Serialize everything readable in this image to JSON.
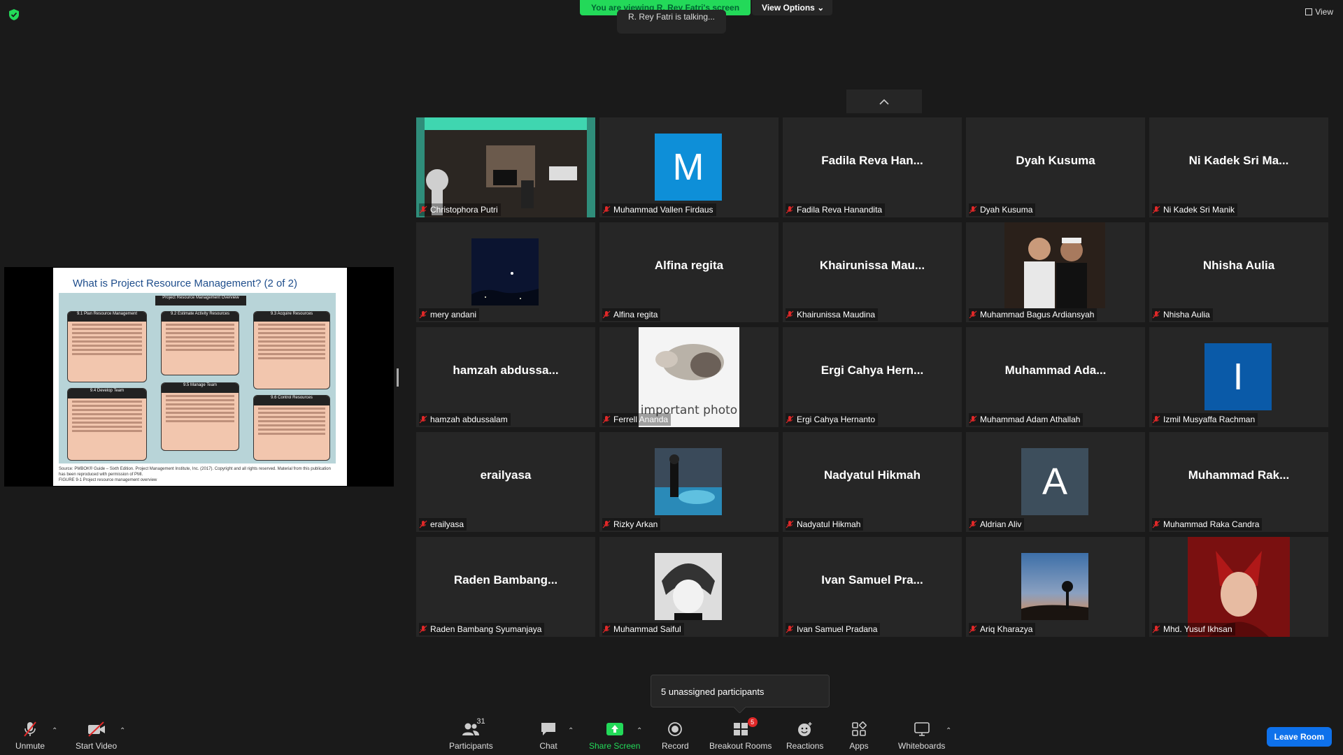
{
  "banner": {
    "viewing_text": "You are viewing R. Rey Fatri's screen",
    "view_options": "View Options",
    "talking": "R. Rey Fatri is talking..."
  },
  "view_label": "View",
  "slide": {
    "title": "What is Project Resource Management? (2 of 2)",
    "diagram_header": "Project Resource Management Overview",
    "boxes": [
      "9.1 Plan Resource Management",
      "9.2 Estimate Activity Resources",
      "9.3 Acquire Resources",
      "9.4 Develop Team",
      "9.5 Manage Team",
      "9.6 Control Resources"
    ],
    "source": "Source: PMBOK® Guide – Sixth Edition. Project Management Institute, Inc. (2017). Copyright and all rights reserved. Material from this publication has been reproduced with permission of PMI.",
    "figure": "FIGURE 9-1   Project resource management overview"
  },
  "participants": [
    {
      "display": "",
      "name": "Christophora Putri",
      "kind": "room-photo"
    },
    {
      "display": "M",
      "name": "Muhammad Vallen Firdaus",
      "kind": "letter",
      "color": "#0e8fd8"
    },
    {
      "display": "Fadila Reva Han...",
      "name": "Fadila Reva Hanandita",
      "kind": "text"
    },
    {
      "display": "Dyah Kusuma",
      "name": "Dyah Kusuma",
      "kind": "text"
    },
    {
      "display": "Ni Kadek Sri Ma...",
      "name": "Ni Kadek Sri Manik",
      "kind": "text"
    },
    {
      "display": "",
      "name": "mery andani",
      "kind": "night-photo"
    },
    {
      "display": "Alfina regita",
      "name": "Alfina regita",
      "kind": "text"
    },
    {
      "display": "Khairunissa  Mau...",
      "name": "Khairunissa Maudina",
      "kind": "text"
    },
    {
      "display": "",
      "name": "Muhammad Bagus Ardiansyah",
      "kind": "people-photo"
    },
    {
      "display": "Nhisha Aulia",
      "name": "Nhisha Aulia",
      "kind": "text"
    },
    {
      "display": "hamzah  abdussa...",
      "name": "hamzah abdussalam",
      "kind": "text"
    },
    {
      "display": "important photo",
      "name": "Ferrell Ananda",
      "kind": "rat-photo"
    },
    {
      "display": "Ergi Cahya Hern...",
      "name": "Ergi Cahya Hernanto",
      "kind": "text"
    },
    {
      "display": "Muhammad  Ada...",
      "name": "Muhammad Adam Athallah",
      "kind": "text"
    },
    {
      "display": "I",
      "name": "Izmil Musyaffa Rachman",
      "kind": "letter",
      "color": "#0a5aa8"
    },
    {
      "display": "erailyasa",
      "name": "erailyasa",
      "kind": "text"
    },
    {
      "display": "",
      "name": "Rizky Arkan",
      "kind": "pool-photo"
    },
    {
      "display": "Nadyatul Hikmah",
      "name": "Nadyatul Hikmah",
      "kind": "text"
    },
    {
      "display": "A",
      "name": "Aldrian Aliv",
      "kind": "letter",
      "color": "#3d4e5c"
    },
    {
      "display": "Muhammad  Rak...",
      "name": "Muhammad Raka Candra",
      "kind": "text"
    },
    {
      "display": "Raden  Bambang...",
      "name": "Raden Bambang Syumanjaya",
      "kind": "text"
    },
    {
      "display": "",
      "name": "Muhammad Saiful",
      "kind": "anime-photo"
    },
    {
      "display": "Ivan Samuel Pra...",
      "name": "Ivan Samuel Pradana",
      "kind": "text"
    },
    {
      "display": "",
      "name": "Ariq Kharazya",
      "kind": "sunset-photo"
    },
    {
      "display": "",
      "name": "Mhd. Yusuf Ikhsan",
      "kind": "witch-photo"
    }
  ],
  "tooltip": "5 unassigned participants",
  "toolbar": {
    "unmute": "Unmute",
    "start_video": "Start Video",
    "participants": "Participants",
    "participants_count": "31",
    "chat": "Chat",
    "share_screen": "Share Screen",
    "record": "Record",
    "breakout_rooms": "Breakout Rooms",
    "breakout_badge": "5",
    "reactions": "Reactions",
    "apps": "Apps",
    "whiteboards": "Whiteboards",
    "leave": "Leave Room"
  },
  "colors": {
    "banner_green": "#23d959",
    "share_green": "#23d959",
    "leave_blue": "#0e71eb",
    "muted_red": "#e02828"
  }
}
